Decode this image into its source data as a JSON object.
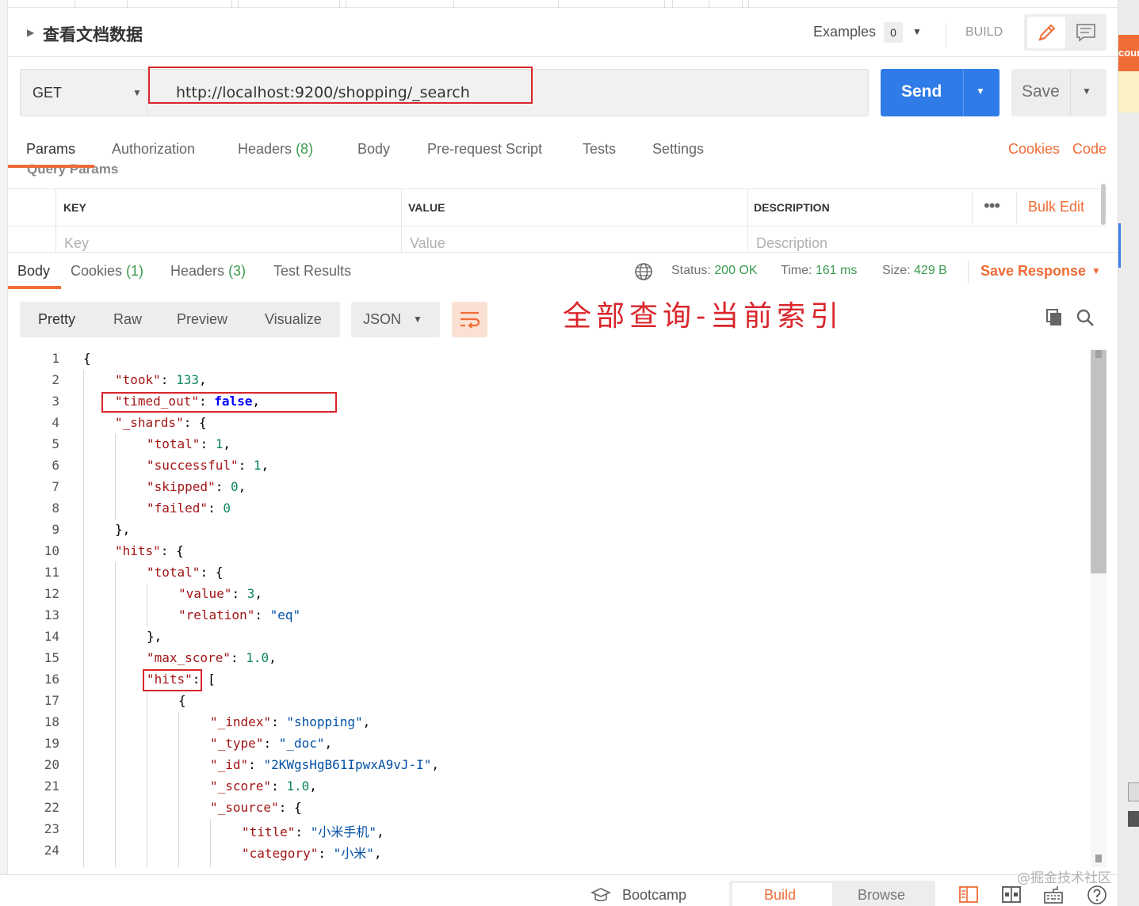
{
  "header": {
    "title": "查看文档数据",
    "examples_label": "Examples",
    "examples_count": "0",
    "build_label": "BUILD"
  },
  "request": {
    "method": "GET",
    "url": "http://localhost:9200/shopping/_search",
    "send_label": "Send",
    "save_label": "Save"
  },
  "request_tabs": [
    {
      "label": "Params",
      "count": ""
    },
    {
      "label": "Authorization",
      "count": ""
    },
    {
      "label": "Headers",
      "count": "(8)"
    },
    {
      "label": "Body",
      "count": ""
    },
    {
      "label": "Pre-request Script",
      "count": ""
    },
    {
      "label": "Tests",
      "count": ""
    },
    {
      "label": "Settings",
      "count": ""
    }
  ],
  "request_links": {
    "cookies": "Cookies",
    "code": "Code"
  },
  "query_params": {
    "title": "Query Params",
    "columns": [
      "KEY",
      "VALUE",
      "DESCRIPTION"
    ],
    "placeholders": [
      "Key",
      "Value",
      "Description"
    ],
    "bulk_edit": "Bulk Edit"
  },
  "response_tabs": [
    {
      "label": "Body",
      "count": ""
    },
    {
      "label": "Cookies",
      "count": "(1)"
    },
    {
      "label": "Headers",
      "count": "(3)"
    },
    {
      "label": "Test Results",
      "count": ""
    }
  ],
  "response_meta": {
    "status_label": "Status:",
    "status_value": "200 OK",
    "time_label": "Time:",
    "time_value": "161 ms",
    "size_label": "Size:",
    "size_value": "429 B",
    "save_response": "Save Response"
  },
  "view_modes": [
    "Pretty",
    "Raw",
    "Preview",
    "Visualize"
  ],
  "language": "JSON",
  "annotation": "全部查询-当前索引",
  "code_lines": [
    {
      "n": "1",
      "indent": 0,
      "parts": [
        [
          "p",
          "{"
        ]
      ]
    },
    {
      "n": "2",
      "indent": 1,
      "parts": [
        [
          "k",
          "\"took\""
        ],
        [
          "p",
          ": "
        ],
        [
          "n",
          "133"
        ],
        [
          "p",
          ","
        ]
      ]
    },
    {
      "n": "3",
      "indent": 1,
      "parts": [
        [
          "k",
          "\"timed_out\""
        ],
        [
          "p",
          ": "
        ],
        [
          "b",
          "false"
        ],
        [
          "p",
          ","
        ]
      ]
    },
    {
      "n": "4",
      "indent": 1,
      "parts": [
        [
          "k",
          "\"_shards\""
        ],
        [
          "p",
          ": {"
        ]
      ]
    },
    {
      "n": "5",
      "indent": 2,
      "parts": [
        [
          "k",
          "\"total\""
        ],
        [
          "p",
          ": "
        ],
        [
          "n",
          "1"
        ],
        [
          "p",
          ","
        ]
      ]
    },
    {
      "n": "6",
      "indent": 2,
      "parts": [
        [
          "k",
          "\"successful\""
        ],
        [
          "p",
          ": "
        ],
        [
          "n",
          "1"
        ],
        [
          "p",
          ","
        ]
      ]
    },
    {
      "n": "7",
      "indent": 2,
      "parts": [
        [
          "k",
          "\"skipped\""
        ],
        [
          "p",
          ": "
        ],
        [
          "n",
          "0"
        ],
        [
          "p",
          ","
        ]
      ]
    },
    {
      "n": "8",
      "indent": 2,
      "parts": [
        [
          "k",
          "\"failed\""
        ],
        [
          "p",
          ": "
        ],
        [
          "n",
          "0"
        ]
      ]
    },
    {
      "n": "9",
      "indent": 1,
      "parts": [
        [
          "p",
          "},"
        ]
      ]
    },
    {
      "n": "10",
      "indent": 1,
      "parts": [
        [
          "k",
          "\"hits\""
        ],
        [
          "p",
          ": {"
        ]
      ]
    },
    {
      "n": "11",
      "indent": 2,
      "parts": [
        [
          "k",
          "\"total\""
        ],
        [
          "p",
          ": {"
        ]
      ]
    },
    {
      "n": "12",
      "indent": 3,
      "parts": [
        [
          "k",
          "\"value\""
        ],
        [
          "p",
          ": "
        ],
        [
          "n",
          "3"
        ],
        [
          "p",
          ","
        ]
      ]
    },
    {
      "n": "13",
      "indent": 3,
      "parts": [
        [
          "k",
          "\"relation\""
        ],
        [
          "p",
          ": "
        ],
        [
          "s",
          "\"eq\""
        ]
      ]
    },
    {
      "n": "14",
      "indent": 2,
      "parts": [
        [
          "p",
          "},"
        ]
      ]
    },
    {
      "n": "15",
      "indent": 2,
      "parts": [
        [
          "k",
          "\"max_score\""
        ],
        [
          "p",
          ": "
        ],
        [
          "n",
          "1.0"
        ],
        [
          "p",
          ","
        ]
      ]
    },
    {
      "n": "16",
      "indent": 2,
      "parts": [
        [
          "k",
          "\"hits\""
        ],
        [
          "p",
          ": ["
        ]
      ]
    },
    {
      "n": "17",
      "indent": 3,
      "parts": [
        [
          "p",
          "{"
        ]
      ]
    },
    {
      "n": "18",
      "indent": 4,
      "parts": [
        [
          "k",
          "\"_index\""
        ],
        [
          "p",
          ": "
        ],
        [
          "s",
          "\"shopping\""
        ],
        [
          "p",
          ","
        ]
      ]
    },
    {
      "n": "19",
      "indent": 4,
      "parts": [
        [
          "k",
          "\"_type\""
        ],
        [
          "p",
          ": "
        ],
        [
          "s",
          "\"_doc\""
        ],
        [
          "p",
          ","
        ]
      ]
    },
    {
      "n": "20",
      "indent": 4,
      "parts": [
        [
          "k",
          "\"_id\""
        ],
        [
          "p",
          ": "
        ],
        [
          "s",
          "\"2KWgsHgB61IpwxA9vJ-I\""
        ],
        [
          "p",
          ","
        ]
      ]
    },
    {
      "n": "21",
      "indent": 4,
      "parts": [
        [
          "k",
          "\"_score\""
        ],
        [
          "p",
          ": "
        ],
        [
          "n",
          "1.0"
        ],
        [
          "p",
          ","
        ]
      ]
    },
    {
      "n": "22",
      "indent": 4,
      "parts": [
        [
          "k",
          "\"_source\""
        ],
        [
          "p",
          ": {"
        ]
      ]
    },
    {
      "n": "23",
      "indent": 5,
      "parts": [
        [
          "k",
          "\"title\""
        ],
        [
          "p",
          ": "
        ],
        [
          "s",
          "\"小米手机\""
        ],
        [
          "p",
          ","
        ]
      ]
    },
    {
      "n": "24",
      "indent": 5,
      "parts": [
        [
          "k",
          "\"category\""
        ],
        [
          "p",
          ": "
        ],
        [
          "s",
          "\"小米\""
        ],
        [
          "p",
          ","
        ]
      ]
    }
  ],
  "status_bar": {
    "bootcamp": "Bootcamp",
    "build": "Build",
    "browse": "Browse"
  },
  "side_panel_text": "cour",
  "watermark": "@掘金技术社区",
  "colors": {
    "accent_orange": "#ef6c36",
    "send_blue": "#2f7be7",
    "success_green": "#3b9b4f",
    "annotation_red": "#d9262b"
  }
}
